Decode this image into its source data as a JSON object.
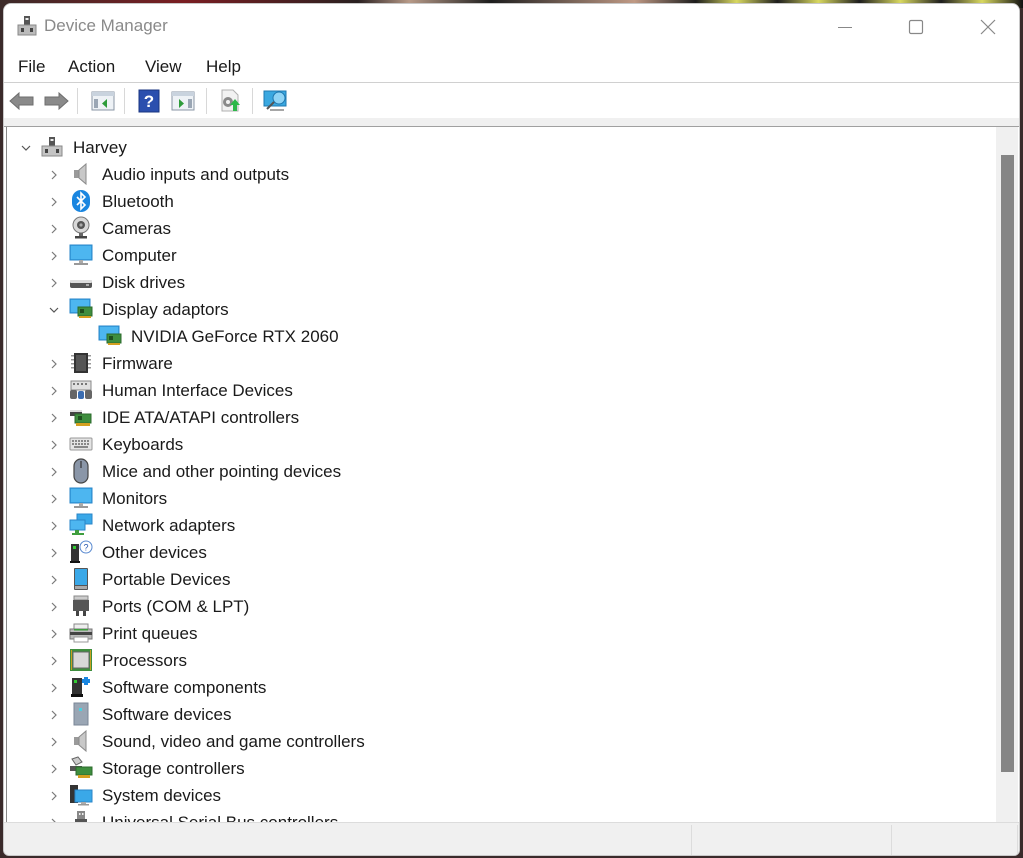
{
  "window": {
    "title": "Device Manager",
    "controls": {
      "minimize": "minimize",
      "maximize": "maximize",
      "close": "close"
    }
  },
  "menu": [
    {
      "label": "File"
    },
    {
      "label": "Action"
    },
    {
      "label": "View"
    },
    {
      "label": "Help"
    }
  ],
  "toolbar": [
    {
      "name": "back-button",
      "icon": "arrow-left-icon"
    },
    {
      "name": "forward-button",
      "icon": "arrow-right-icon"
    },
    {
      "name": "show-hide-console-tree-button",
      "icon": "console-tree-icon"
    },
    {
      "name": "help-button",
      "icon": "help-icon"
    },
    {
      "name": "show-hide-action-pane-button",
      "icon": "action-pane-icon"
    },
    {
      "name": "update-driver-button",
      "icon": "update-driver-icon"
    },
    {
      "name": "scan-hardware-button",
      "icon": "scan-hardware-icon"
    }
  ],
  "tree": {
    "root": {
      "label": "Harvey",
      "expanded": true,
      "icon": "computer-tower-icon"
    },
    "categories": [
      {
        "label": "Audio inputs and outputs",
        "icon": "speaker-icon",
        "expanded": false
      },
      {
        "label": "Bluetooth",
        "icon": "bluetooth-icon",
        "expanded": false
      },
      {
        "label": "Cameras",
        "icon": "webcam-icon",
        "expanded": false
      },
      {
        "label": "Computer",
        "icon": "monitor-icon",
        "expanded": false
      },
      {
        "label": "Disk drives",
        "icon": "disk-drive-icon",
        "expanded": false
      },
      {
        "label": "Display adaptors",
        "icon": "display-adapter-icon",
        "expanded": true,
        "children": [
          {
            "label": "NVIDIA GeForce RTX 2060",
            "icon": "display-adapter-icon"
          }
        ]
      },
      {
        "label": "Firmware",
        "icon": "chip-icon",
        "expanded": false
      },
      {
        "label": "Human Interface Devices",
        "icon": "hid-icon",
        "expanded": false
      },
      {
        "label": "IDE ATA/ATAPI controllers",
        "icon": "controller-card-icon",
        "expanded": false
      },
      {
        "label": "Keyboards",
        "icon": "keyboard-icon",
        "expanded": false
      },
      {
        "label": "Mice and other pointing devices",
        "icon": "mouse-icon",
        "expanded": false
      },
      {
        "label": "Monitors",
        "icon": "monitor-icon",
        "expanded": false
      },
      {
        "label": "Network adapters",
        "icon": "network-icon",
        "expanded": false
      },
      {
        "label": "Other devices",
        "icon": "unknown-device-icon",
        "expanded": false
      },
      {
        "label": "Portable Devices",
        "icon": "portable-device-icon",
        "expanded": false
      },
      {
        "label": "Ports (COM & LPT)",
        "icon": "port-icon",
        "expanded": false
      },
      {
        "label": "Print queues",
        "icon": "printer-icon",
        "expanded": false
      },
      {
        "label": "Processors",
        "icon": "processor-icon",
        "expanded": false
      },
      {
        "label": "Software components",
        "icon": "software-component-icon",
        "expanded": false
      },
      {
        "label": "Software devices",
        "icon": "software-device-icon",
        "expanded": false
      },
      {
        "label": "Sound, video and game controllers",
        "icon": "speaker-icon",
        "expanded": false
      },
      {
        "label": "Storage controllers",
        "icon": "storage-controller-icon",
        "expanded": false
      },
      {
        "label": "System devices",
        "icon": "system-devices-icon",
        "expanded": false
      },
      {
        "label": "Universal Serial Bus controllers",
        "icon": "usb-icon",
        "expanded": false
      }
    ]
  },
  "colors": {
    "accent_blue": "#3aa0e8",
    "chip_green": "#3e8e3e",
    "scroll_thumb": "#858585",
    "status_bg": "#f0f0f0"
  }
}
